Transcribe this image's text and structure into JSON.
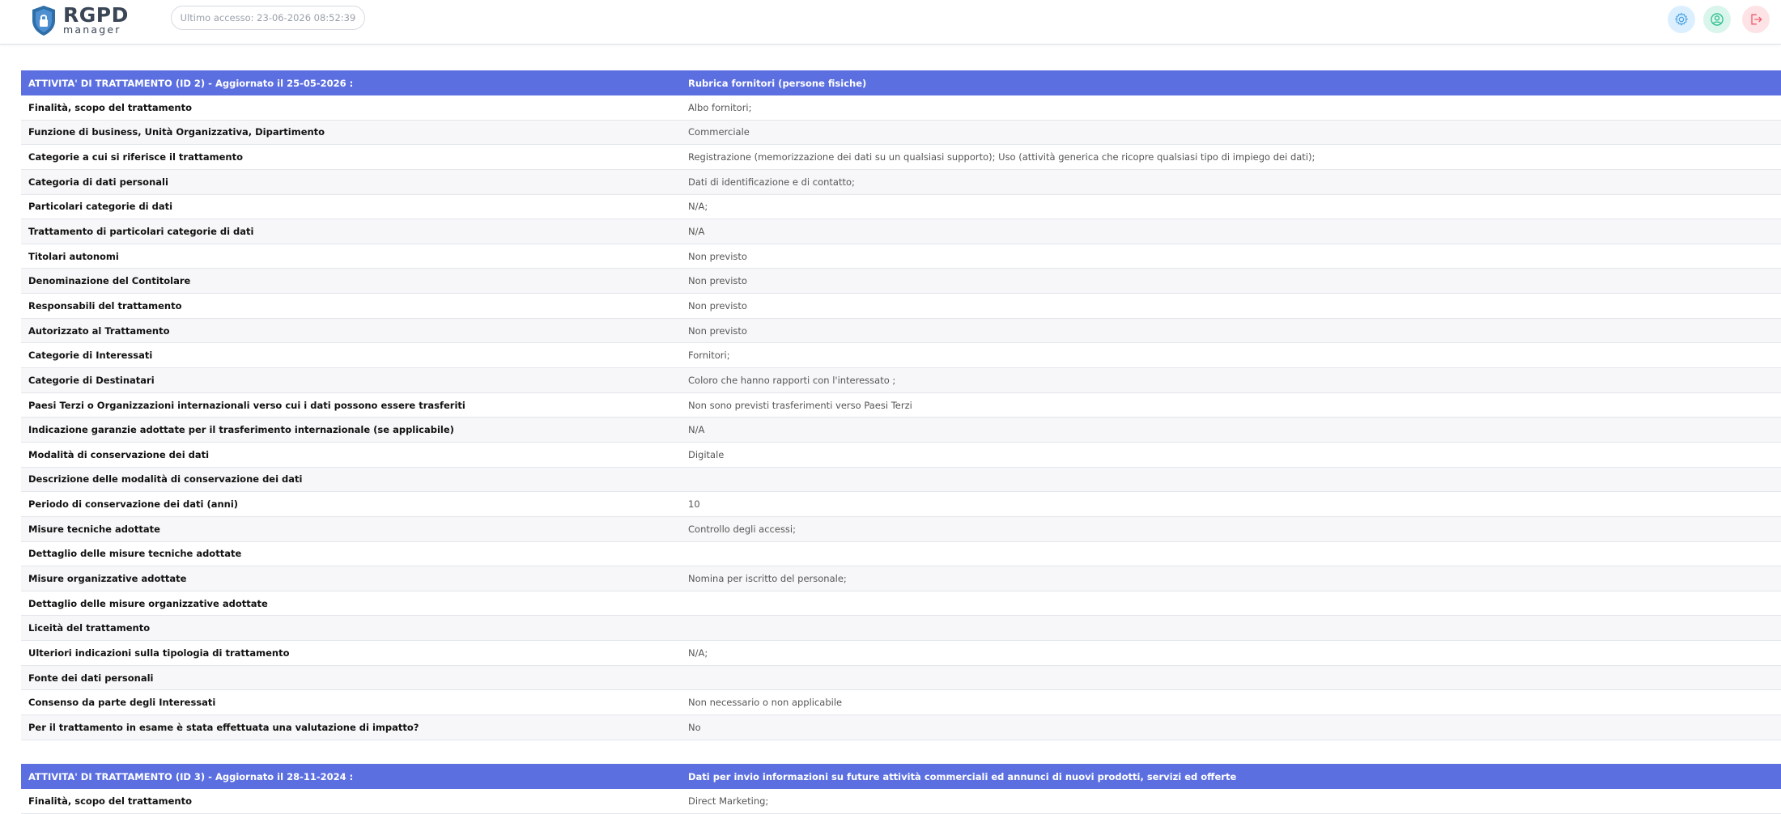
{
  "app": {
    "logo_main": "RGPD",
    "logo_sub": "manager"
  },
  "header": {
    "last_access": "Ultimo accesso: 23-06-2026 08:52:39",
    "icons": [
      "settings-icon",
      "user-icon",
      "logout-icon"
    ]
  },
  "colors": {
    "section_header": "#5b6fe0",
    "accent": "#3a4656"
  },
  "sections": [
    {
      "title": "ATTIVITA' DI TRATTAMENTO (ID 2) - Aggiornato il 25-05-2026 :",
      "name": "Rubrica fornitori (persone fisiche)",
      "rows": [
        {
          "label": "Finalità, scopo del trattamento",
          "value": "Albo fornitori;"
        },
        {
          "label": "Funzione di business, Unità Organizzativa, Dipartimento",
          "value": "Commerciale"
        },
        {
          "label": "Categorie a cui si riferisce il trattamento",
          "value": "Registrazione (memorizzazione dei dati su un qualsiasi supporto); Uso (attività generica che ricopre qualsiasi tipo di impiego dei dati);"
        },
        {
          "label": "Categoria di dati personali",
          "value": "Dati di identificazione e di contatto;"
        },
        {
          "label": "Particolari categorie di dati",
          "value": "N/A;"
        },
        {
          "label": "Trattamento di particolari categorie di dati",
          "value": "N/A"
        },
        {
          "label": "Titolari autonomi",
          "value": "Non previsto"
        },
        {
          "label": "Denominazione del Contitolare",
          "value": "Non previsto"
        },
        {
          "label": "Responsabili del trattamento",
          "value": "Non previsto"
        },
        {
          "label": "Autorizzato al Trattamento",
          "value": "Non previsto"
        },
        {
          "label": "Categorie di Interessati",
          "value": "Fornitori;"
        },
        {
          "label": "Categorie di Destinatari",
          "value": "Coloro che hanno rapporti con l'interessato ;"
        },
        {
          "label": "Paesi Terzi o Organizzazioni internazionali verso cui i dati possono essere trasferiti",
          "value": "Non sono previsti trasferimenti verso Paesi Terzi"
        },
        {
          "label": "Indicazione garanzie adottate per il trasferimento internazionale (se applicabile)",
          "value": "N/A"
        },
        {
          "label": "Modalità di conservazione dei dati",
          "value": "Digitale"
        },
        {
          "label": "Descrizione delle modalità di conservazione dei dati",
          "value": ""
        },
        {
          "label": "Periodo di conservazione dei dati (anni)",
          "value": "10"
        },
        {
          "label": "Misure tecniche adottate",
          "value": "Controllo degli accessi;"
        },
        {
          "label": "Dettaglio delle misure tecniche adottate",
          "value": ""
        },
        {
          "label": "Misure organizzative adottate",
          "value": "Nomina per iscritto del personale;"
        },
        {
          "label": "Dettaglio delle misure organizzative adottate",
          "value": ""
        },
        {
          "label": "Liceità del trattamento",
          "value": ""
        },
        {
          "label": "Ulteriori indicazioni sulla tipologia di trattamento",
          "value": "N/A;"
        },
        {
          "label": "Fonte dei dati personali",
          "value": ""
        },
        {
          "label": "Consenso da parte degli Interessati",
          "value": "Non necessario o non applicabile"
        },
        {
          "label": "Per il trattamento in esame è stata effettuata una valutazione di impatto?",
          "value": "No"
        }
      ]
    },
    {
      "title": "ATTIVITA' DI TRATTAMENTO (ID 3) - Aggiornato il 28-11-2024 :",
      "name": "Dati per invio informazioni su future attività commerciali ed annunci di nuovi prodotti, servizi ed offerte",
      "rows": [
        {
          "label": "Finalità, scopo del trattamento",
          "value": "Direct Marketing;"
        }
      ]
    }
  ]
}
